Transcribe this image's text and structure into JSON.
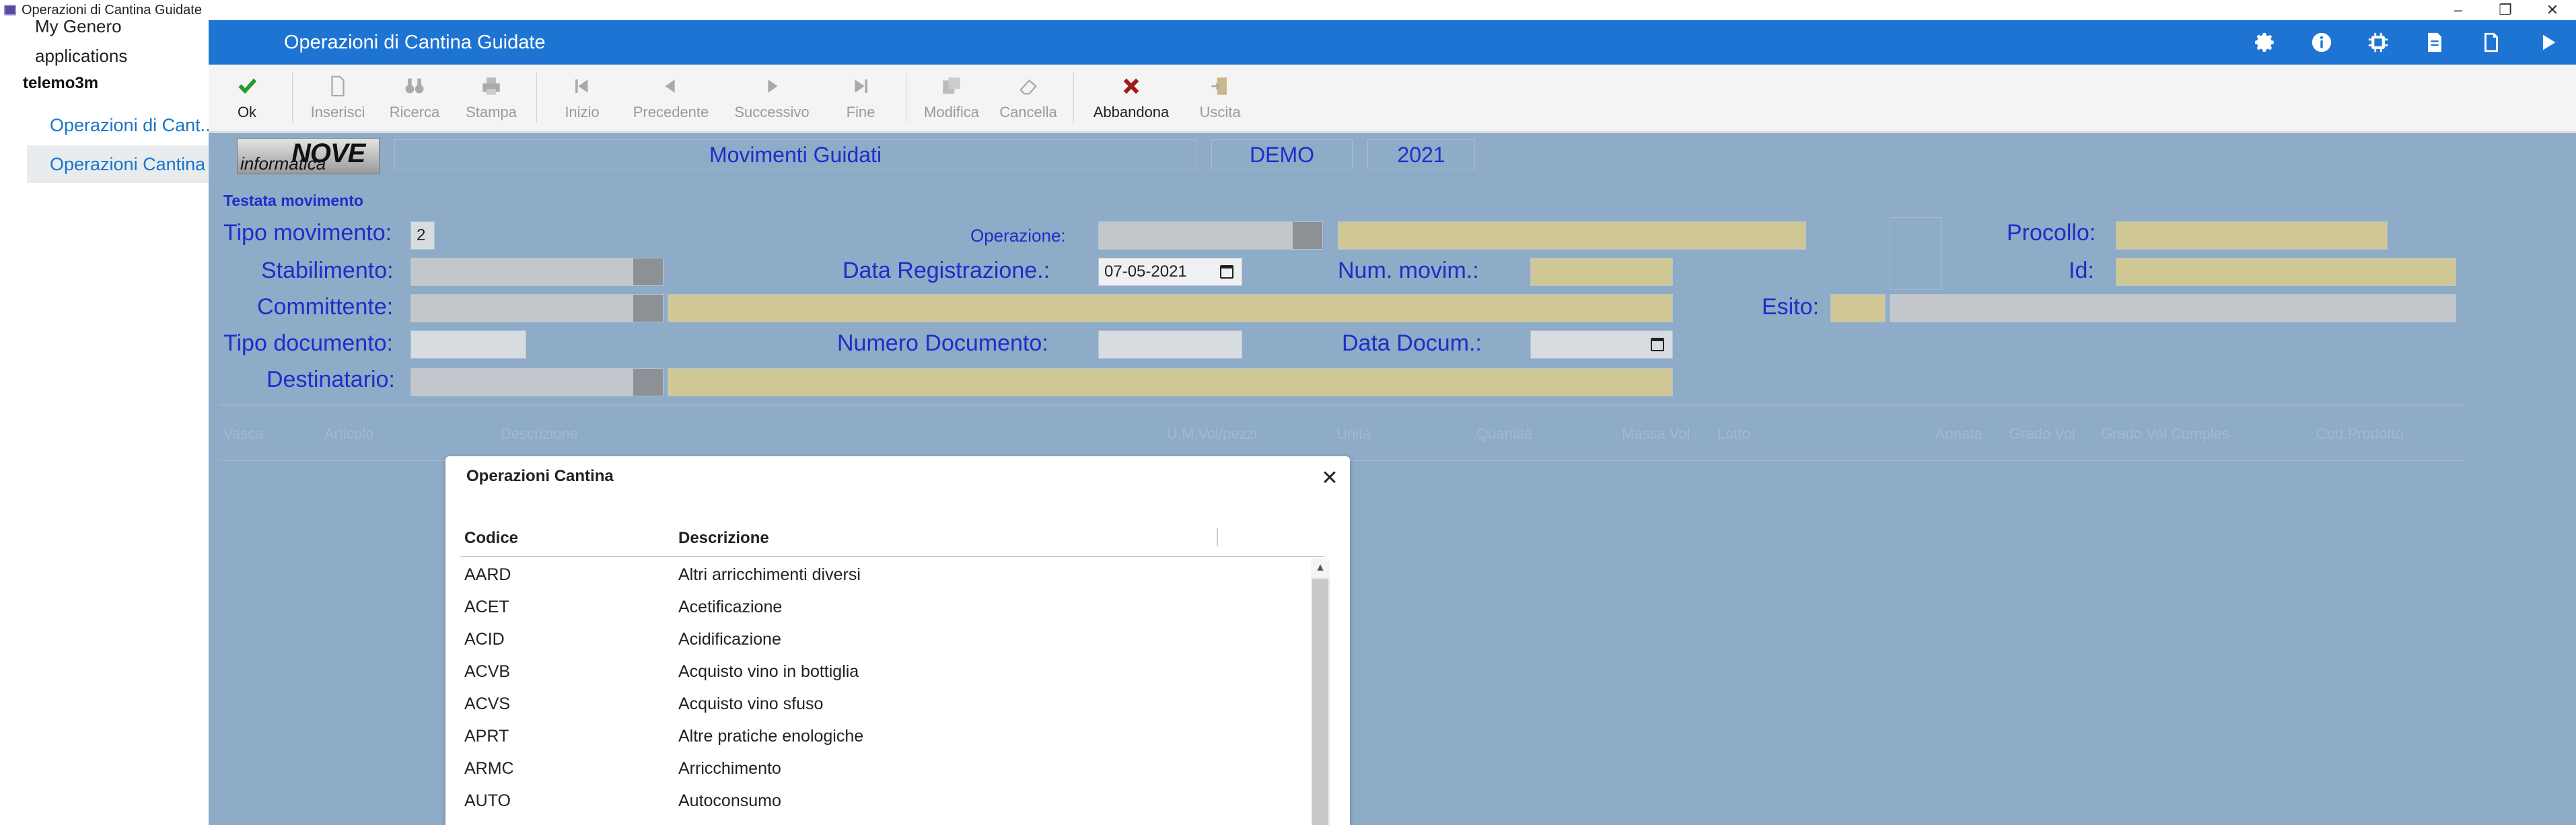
{
  "window": {
    "title": "Operazioni di Cantina Guidate"
  },
  "nav": {
    "heading1": "My Genero",
    "heading2": "applications",
    "user": "telemo3m",
    "links": [
      "Operazioni di Cant...",
      "Operazioni Cantina"
    ]
  },
  "header": {
    "title": "Operazioni di Cantina Guidate",
    "icons": [
      "gear-icon",
      "info-icon",
      "chip-icon",
      "document-icon",
      "new-document-icon",
      "play-icon"
    ]
  },
  "toolbar": {
    "ok": "Ok",
    "inserisci": "Inserisci",
    "ricerca": "Ricerca",
    "stampa": "Stampa",
    "inizio": "Inizio",
    "precedente": "Precedente",
    "successivo": "Successivo",
    "fine": "Fine",
    "modifica": "Modifica",
    "cancella": "Cancella",
    "abbandona": "Abbandona",
    "uscita": "Uscita"
  },
  "banner": {
    "logo_small": "informatica",
    "logo_big": "NOVE",
    "title": "Movimenti Guidati",
    "company": "DEMO",
    "year": "2021"
  },
  "form": {
    "section": "Testata movimento",
    "tipo_movimento_label": "Tipo movimento:",
    "tipo_movimento_value": "2",
    "operazione_label": "Operazione:",
    "procollo_label": "Procollo:",
    "stabilimento_label": "Stabilimento:",
    "data_registrazione_label": "Data Registrazione.:",
    "data_registrazione_value": "07-05-2021",
    "num_movim_label": "Num. movim.:",
    "id_label": "Id:",
    "committente_label": "Committente:",
    "esito_label": "Esito:",
    "tipo_documento_label": "Tipo documento:",
    "numero_documento_label": "Numero Documento:",
    "data_docum_label": "Data Docum.:",
    "destinatario_label": "Destinatario:"
  },
  "grid": {
    "columns": [
      "Vasca",
      "Articolo",
      "Descrizione",
      "U.M.Vol/pezzi",
      "Unità",
      "Quantità",
      "Massa Vol",
      "Lotto",
      "Annata",
      "Grado Vol",
      "Grado Vol Comples",
      "Cod.Prodotto"
    ]
  },
  "dialog": {
    "title": "Operazioni Cantina",
    "col_codice": "Codice",
    "col_descrizione": "Descrizione",
    "rows": [
      {
        "codice": "AARD",
        "descrizione": "Altri arricchimenti diversi"
      },
      {
        "codice": "ACET",
        "descrizione": "Acetificazione"
      },
      {
        "codice": "ACID",
        "descrizione": "Acidificazione"
      },
      {
        "codice": "ACVB",
        "descrizione": "Acquisto vino in bottiglia"
      },
      {
        "codice": "ACVS",
        "descrizione": "Acquisto vino sfuso"
      },
      {
        "codice": "APRT",
        "descrizione": "Altre pratiche enologiche"
      },
      {
        "codice": "ARMC",
        "descrizione": "Arricchimento"
      },
      {
        "codice": "AUTO",
        "descrizione": "Autoconsumo"
      }
    ]
  }
}
